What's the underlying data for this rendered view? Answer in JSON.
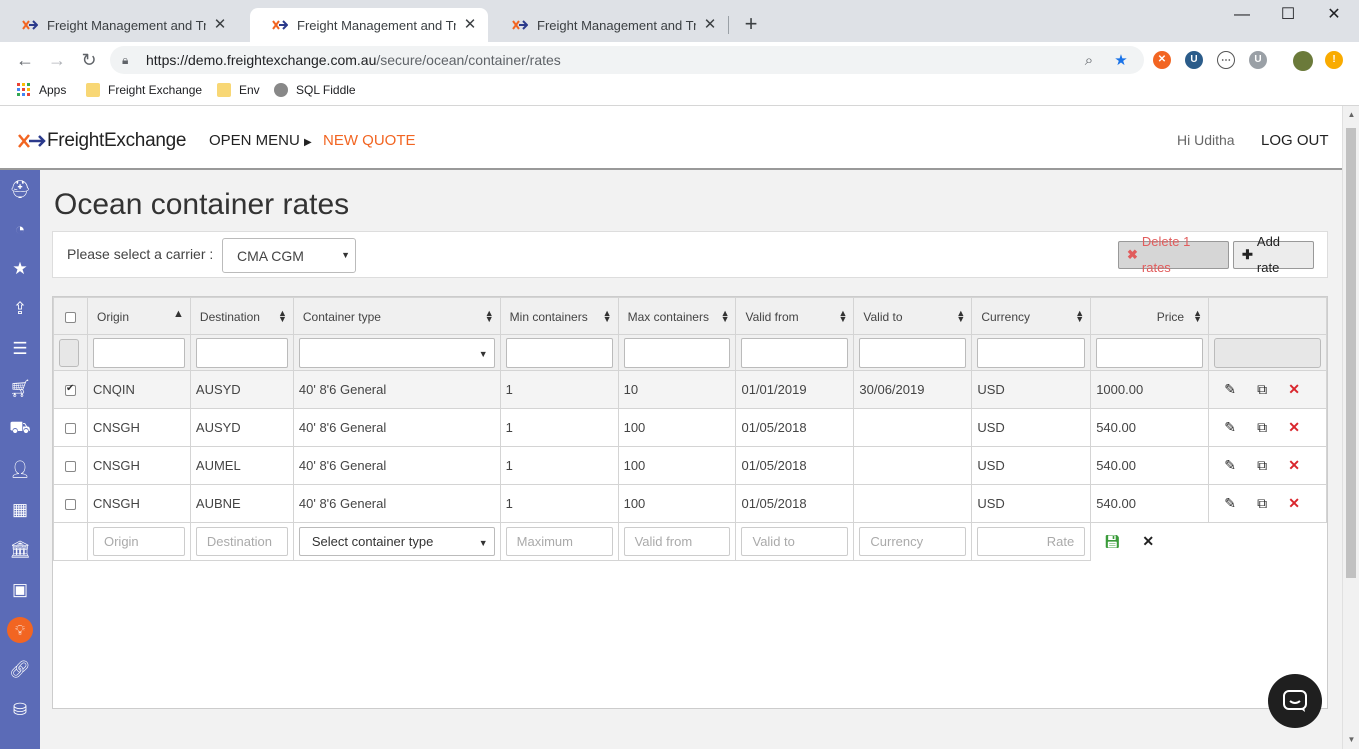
{
  "browser": {
    "tabs": [
      {
        "title": "Freight Management and Transp",
        "active": false
      },
      {
        "title": "Freight Management and Transp",
        "active": true
      },
      {
        "title": "Freight Management and Transp",
        "active": false
      }
    ],
    "url_host": "https://demo.freightexchange.com.au",
    "url_path": "/secure/ocean/container/rates",
    "bookmarks": [
      "Apps",
      "Freight Exchange",
      "Env",
      "SQL Fiddle"
    ]
  },
  "header": {
    "logo_text": "FreightExchange",
    "open_menu": "OPEN MENU",
    "new_quote": "NEW QUOTE",
    "greeting": "Hi Uditha",
    "logout": "LOG OUT"
  },
  "sidebar_icons": [
    "user-icon",
    "dashboard-icon",
    "star-icon",
    "upload-icon",
    "list-icon",
    "cart-icon",
    "truck-icon",
    "person-icon",
    "building-icon",
    "bank-icon",
    "money-icon",
    "lightbulb-icon",
    "link-icon",
    "database-icon"
  ],
  "page": {
    "title": "Ocean container rates",
    "carrier_label": "Please select a carrier :",
    "carrier_value": "CMA CGM",
    "delete_button": "Delete 1 rates",
    "add_button": "Add rate"
  },
  "grid": {
    "columns": [
      "Origin",
      "Destination",
      "Container type",
      "Min containers",
      "Max containers",
      "Valid from",
      "Valid to",
      "Currency",
      "Price"
    ],
    "rows": [
      {
        "checked": true,
        "origin": "CNQIN",
        "destination": "AUSYD",
        "container_type": "40' 8'6 General",
        "min": "1",
        "max": "10",
        "valid_from": "01/01/2019",
        "valid_to": "30/06/2019",
        "currency": "USD",
        "price": "1000.00"
      },
      {
        "checked": false,
        "origin": "CNSGH",
        "destination": "AUSYD",
        "container_type": "40' 8'6 General",
        "min": "1",
        "max": "100",
        "valid_from": "01/05/2018",
        "valid_to": "",
        "currency": "USD",
        "price": "540.00"
      },
      {
        "checked": false,
        "origin": "CNSGH",
        "destination": "AUMEL",
        "container_type": "40' 8'6 General",
        "min": "1",
        "max": "100",
        "valid_from": "01/05/2018",
        "valid_to": "",
        "currency": "USD",
        "price": "540.00"
      },
      {
        "checked": false,
        "origin": "CNSGH",
        "destination": "AUBNE",
        "container_type": "40' 8'6 General",
        "min": "1",
        "max": "100",
        "valid_from": "01/05/2018",
        "valid_to": "",
        "currency": "USD",
        "price": "540.00"
      }
    ],
    "add_row": {
      "origin_placeholder": "Origin",
      "destination_placeholder": "Destination",
      "container_select": "Select container type",
      "max_placeholder": "Maximum",
      "valid_from_placeholder": "Valid from",
      "valid_to_placeholder": "Valid to",
      "currency_placeholder": "Currency",
      "rate_placeholder": "Rate"
    }
  },
  "colors": {
    "sidebar": "#5b6bb7",
    "accent_orange": "#f26522",
    "delete_red": "#d9262d"
  }
}
